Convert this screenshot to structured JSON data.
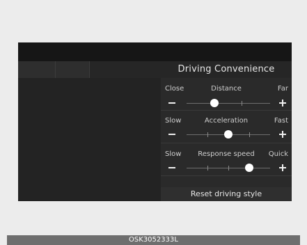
{
  "panel": {
    "title": "Driving Convenience",
    "settings": [
      {
        "name": "Distance",
        "left_label": "Close",
        "right_label": "Far",
        "level": 0.33,
        "ticks": [
          0.66
        ]
      },
      {
        "name": "Acceleration",
        "left_label": "Slow",
        "right_label": "Fast",
        "level": 0.5,
        "ticks": [
          0.25,
          0.75
        ]
      },
      {
        "name": "Response speed",
        "left_label": "Slow",
        "right_label": "Quick",
        "level": 0.75,
        "ticks": [
          0.25,
          0.5
        ]
      }
    ],
    "reset_label": "Reset driving style"
  },
  "caption": "OSK3052333L",
  "colors": {
    "screen_bg": "#1f1f1f",
    "knob": "#ffffff",
    "text": "#e6e6e6"
  },
  "icons": {
    "decrease": "minus-icon",
    "increase": "plus-icon"
  }
}
